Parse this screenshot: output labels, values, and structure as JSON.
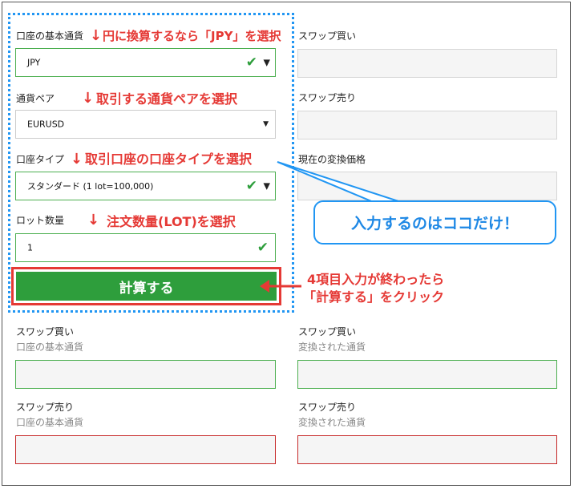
{
  "left": {
    "base_currency": {
      "label": "口座の基本通貨",
      "value": "JPY"
    },
    "pair": {
      "label": "通貨ペア",
      "value": "EURUSD"
    },
    "account_type": {
      "label": "口座タイプ",
      "value": "スタンダード (1 lot=100,000)"
    },
    "lot": {
      "label": "ロット数量",
      "value": "1"
    },
    "calculate_button": "計算する"
  },
  "right": {
    "swap_buy_label": "スワップ買い",
    "swap_sell_label": "スワップ売り",
    "conversion_label": "現在の変換価格"
  },
  "results": {
    "left_swap_buy": {
      "label": "スワップ買い",
      "sub": "口座の基本通貨"
    },
    "left_swap_sell": {
      "label": "スワップ売り",
      "sub": "口座の基本通貨"
    },
    "right_swap_buy": {
      "label": "スワップ買い",
      "sub": "変換された通貨"
    },
    "right_swap_sell": {
      "label": "スワップ売り",
      "sub": "変換された通貨"
    }
  },
  "annotations": {
    "a1": "円に換算するなら「JPY」を選択",
    "a2": "取引する通貨ペアを選択",
    "a3": "取引口座の口座タイプを選択",
    "a4": "注文数量(LOT)を選択",
    "a5_line1": "4項目入力が終わったら",
    "a5_line2": "「計算する」をクリック",
    "callout": "入力するのはココだけ！"
  },
  "colors": {
    "green": "#2e9e3c",
    "red": "#e53935",
    "blue": "#2196f3"
  }
}
